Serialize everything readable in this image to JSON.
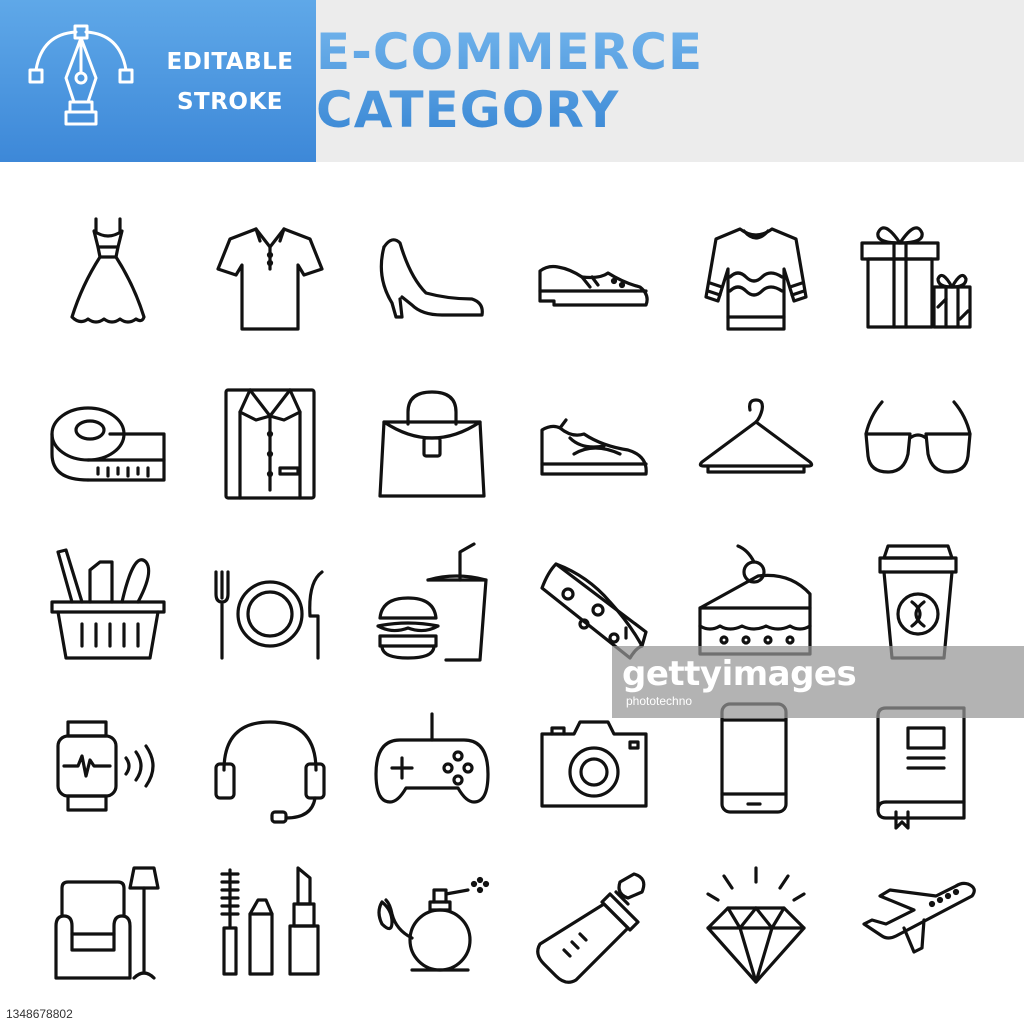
{
  "header": {
    "badge_line1": "EDITABLE",
    "badge_line2": "STROKE",
    "title": "E-COMMERCE CATEGORY",
    "badge_icon": "pen-tool-icon"
  },
  "colors": {
    "accent_blue": "#3d88d8",
    "accent_blue_light": "#5fa8e8",
    "header_bg": "#ececec",
    "icon_stroke": "#111111"
  },
  "icons": [
    [
      "dress-icon",
      "polo-shirt-icon",
      "high-heel-icon",
      "dress-shoe-icon",
      "sweater-icon",
      "gift-box-icon"
    ],
    [
      "measuring-tape-icon",
      "folded-shirt-icon",
      "handbag-icon",
      "sneaker-icon",
      "hanger-icon",
      "sunglasses-icon"
    ],
    [
      "grocery-basket-icon",
      "plate-cutlery-icon",
      "fast-food-icon",
      "pizza-slice-icon",
      "cake-slice-icon",
      "coffee-cup-icon"
    ],
    [
      "smartwatch-icon",
      "headset-icon",
      "game-controller-icon",
      "camera-icon",
      "smartphone-icon",
      "book-icon"
    ],
    [
      "armchair-lamp-icon",
      "cosmetics-icon",
      "perfume-icon",
      "baby-bottle-icon",
      "diamond-icon",
      "airplane-icon"
    ]
  ],
  "watermark": {
    "title": "gettyimages",
    "credit": "phototechno"
  },
  "footer": {
    "image_id": "1348678802"
  }
}
